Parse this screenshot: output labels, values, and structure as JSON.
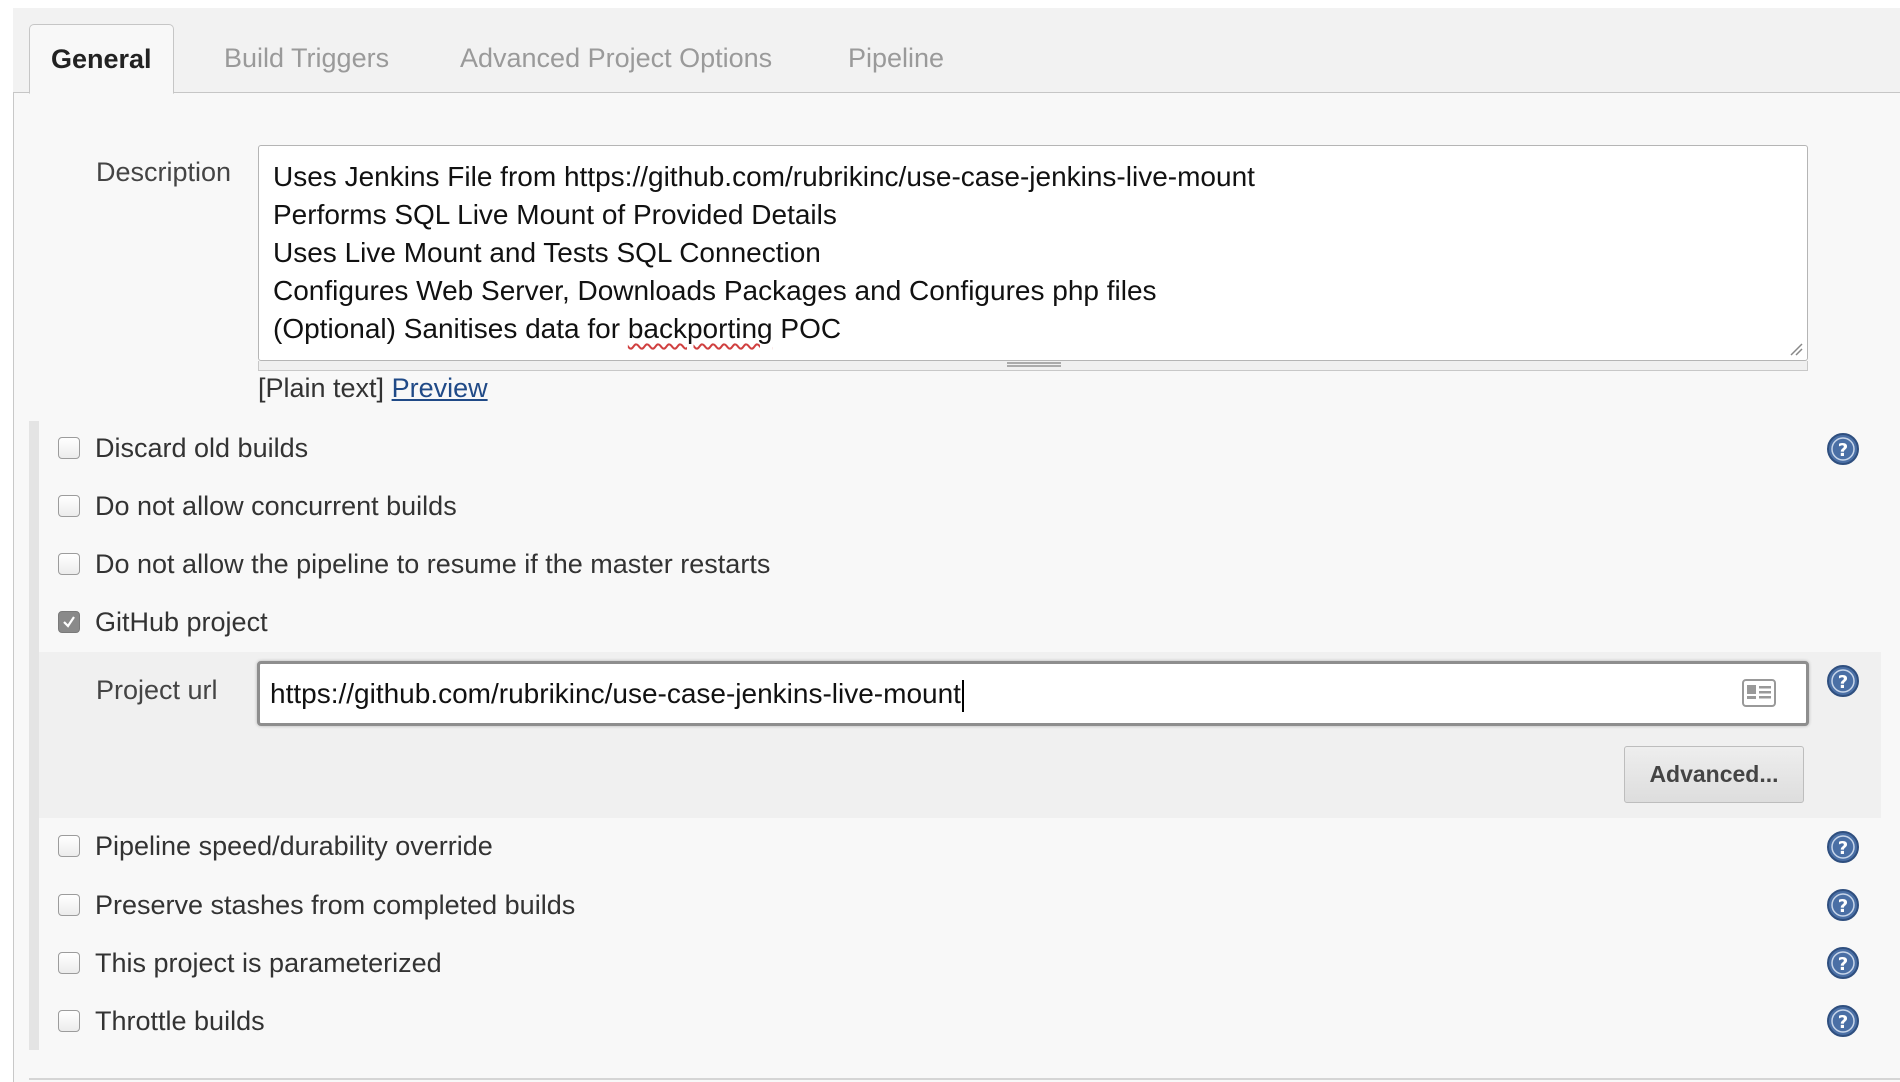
{
  "tabs": [
    {
      "label": "General",
      "active": true
    },
    {
      "label": "Build Triggers",
      "active": false
    },
    {
      "label": "Advanced Project Options",
      "active": false
    },
    {
      "label": "Pipeline",
      "active": false
    }
  ],
  "description": {
    "label": "Description",
    "lines": [
      "Uses Jenkins File from https://github.com/rubrikinc/use-case-jenkins-live-mount",
      "Performs SQL Live Mount of Provided Details",
      "Uses Live Mount and Tests SQL Connection",
      "Configures Web Server, Downloads Packages and Configures php files"
    ],
    "last_line_prefix": "(Optional) Sanitises data for ",
    "last_line_misspelled": "backporting",
    "last_line_suffix": " POC",
    "format_label": "[Plain text]",
    "preview_link": "Preview"
  },
  "options": {
    "discard_old_builds": {
      "label": "Discard old builds",
      "checked": false
    },
    "no_concurrent": {
      "label": "Do not allow concurrent builds",
      "checked": false
    },
    "no_resume": {
      "label": "Do not allow the pipeline to resume if the master restarts",
      "checked": false
    },
    "github_project": {
      "label": "GitHub project",
      "checked": true
    },
    "durability_override": {
      "label": "Pipeline speed/durability override",
      "checked": false
    },
    "preserve_stashes": {
      "label": "Preserve stashes from completed builds",
      "checked": false
    },
    "parameterized": {
      "label": "This project is parameterized",
      "checked": false
    },
    "throttle": {
      "label": "Throttle builds",
      "checked": false
    }
  },
  "github": {
    "project_url_label": "Project url",
    "project_url_value": "https://github.com/rubrikinc/use-case-jenkins-live-mount",
    "advanced_button": "Advanced..."
  },
  "icons": {
    "help": "help-icon",
    "checkmark": "checkmark-icon",
    "address_card": "address-card-icon",
    "resize_grip": "resize-grip-icon"
  },
  "colors": {
    "link": "#204a87",
    "help_icon": "#4a6fa5",
    "checked_box": "#8a8a8a"
  }
}
